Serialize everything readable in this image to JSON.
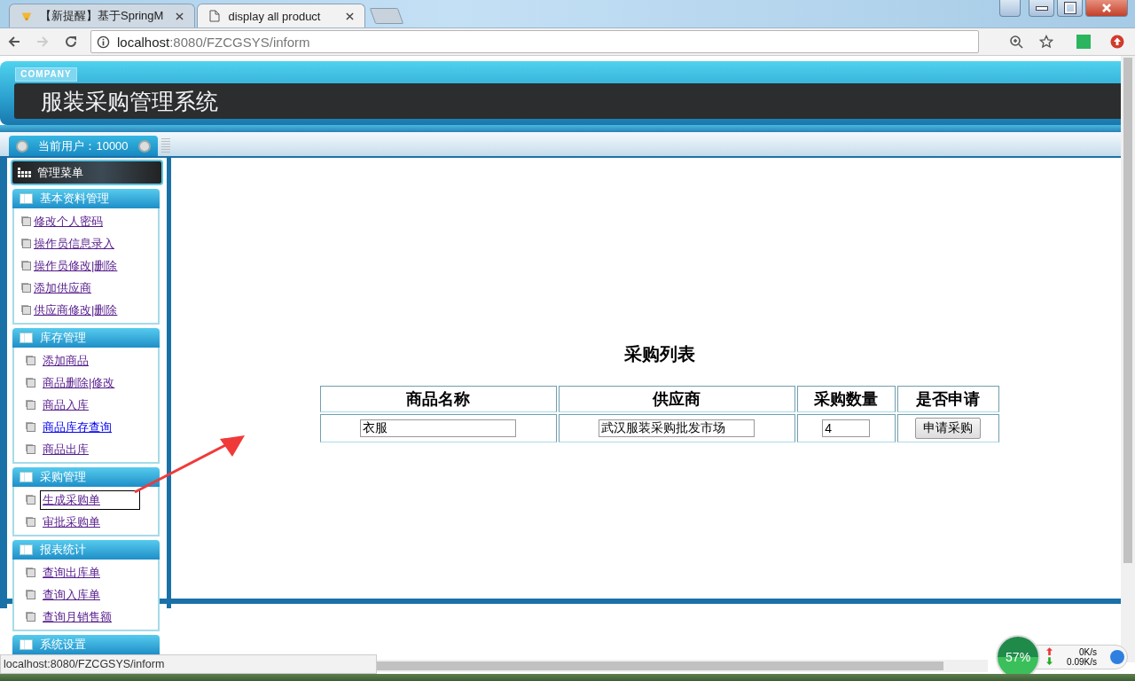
{
  "browser": {
    "tabs": [
      {
        "title": "【新提醒】基于SpringM",
        "selected": false
      },
      {
        "title": "display all product",
        "selected": true
      }
    ],
    "address": {
      "host": "localhost",
      "path": ":8080/FZCGSYS/inform"
    },
    "status_url": "localhost:8080/FZCGSYS/inform"
  },
  "header": {
    "company": "COMPANY",
    "title": "服装采购管理系统"
  },
  "user_label": "当前用户：10000",
  "menu": {
    "title": "管理菜单",
    "groups": [
      {
        "title": "基本资料管理",
        "items": [
          {
            "label": "修改个人密码",
            "visited": true,
            "focused": false
          },
          {
            "label": "操作员信息录入",
            "visited": true,
            "focused": false
          },
          {
            "label": "操作员修改|删除",
            "visited": true,
            "focused": false
          },
          {
            "label": "添加供应商",
            "visited": true,
            "focused": false
          },
          {
            "label": "供应商修改|删除",
            "visited": true,
            "focused": false
          }
        ]
      },
      {
        "title": "库存管理",
        "items": [
          {
            "label": "添加商品",
            "visited": true,
            "focused": false
          },
          {
            "label": "商品删除|修改",
            "visited": true,
            "focused": false
          },
          {
            "label": "商品入库",
            "visited": true,
            "focused": false
          },
          {
            "label": "商品库存查询",
            "visited": false,
            "focused": false
          },
          {
            "label": "商品出库",
            "visited": true,
            "focused": false
          }
        ]
      },
      {
        "title": "采购管理",
        "items": [
          {
            "label": "生成采购单",
            "visited": true,
            "focused": true
          },
          {
            "label": "审批采购单",
            "visited": true,
            "focused": false
          }
        ]
      },
      {
        "title": "报表统计",
        "items": [
          {
            "label": "查询出库单",
            "visited": true,
            "focused": false
          },
          {
            "label": "查询入库单",
            "visited": true,
            "focused": false
          },
          {
            "label": "查询月销售额",
            "visited": true,
            "focused": false
          }
        ]
      },
      {
        "title": "系统设置"
      }
    ]
  },
  "content": {
    "title": "采购列表",
    "columns": [
      "商品名称",
      "供应商",
      "采购数量",
      "是否申请"
    ],
    "rows": [
      {
        "name": "衣服",
        "supplier": "武汉服装采购批发市场",
        "quantity": "4",
        "action": "申请采购"
      }
    ]
  },
  "widget": {
    "percent": "57%",
    "upload": "0K/s",
    "download": "0.09K/s"
  }
}
